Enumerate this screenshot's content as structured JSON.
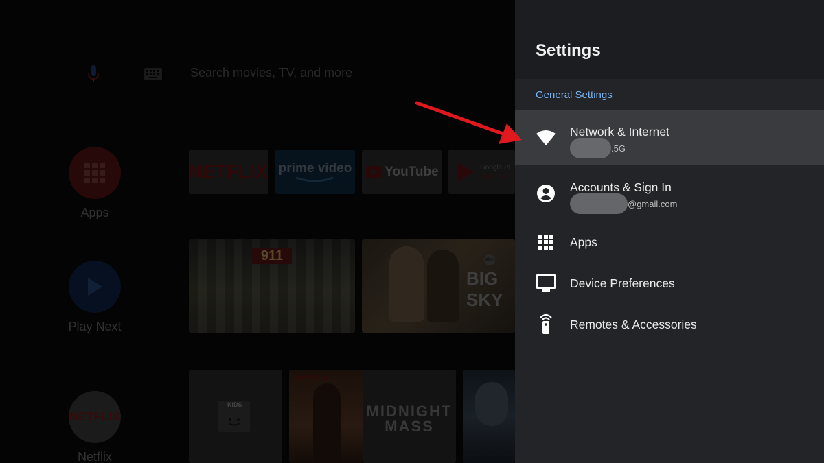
{
  "home": {
    "search_placeholder": "Search movies, TV, and more",
    "rail": [
      {
        "label": "Apps",
        "icon": "grid-icon"
      },
      {
        "label": "Play Next",
        "icon": "play-icon"
      },
      {
        "label": "Netflix",
        "icon": "netflix-logo",
        "logo_text": "NETFLIX"
      }
    ],
    "app_tiles": [
      {
        "name": "NETFLIX"
      },
      {
        "name": "prime video"
      },
      {
        "name": "YouTube"
      },
      {
        "name": "Google Play Movies & TV",
        "line1": "Google Pl",
        "line2": "Movies & T"
      }
    ],
    "media_row1": [
      {
        "title": "911"
      },
      {
        "title": "BIG SKY",
        "badge": "abc"
      }
    ],
    "media_row2": [
      {
        "title": "KIDS"
      },
      {
        "title": "NETFLIX"
      },
      {
        "title_line1": "MIDNIGHT",
        "title_line2": "MASS"
      },
      {
        "title": ""
      }
    ]
  },
  "settings": {
    "title": "Settings",
    "section": "General Settings",
    "rows": [
      {
        "title": "Network & Internet",
        "subtitle_suffix": ".5G",
        "icon": "wifi-icon",
        "selected": true
      },
      {
        "title": "Accounts & Sign In",
        "subtitle_suffix": "@gmail.com",
        "icon": "account-circle-icon"
      },
      {
        "title": "Apps",
        "icon": "apps-grid-icon"
      },
      {
        "title": "Device Preferences",
        "icon": "tv-icon"
      },
      {
        "title": "Remotes & Accessories",
        "icon": "remote-icon"
      }
    ]
  },
  "colors": {
    "panel_bg": "#222427",
    "selected_row": "#393b3f",
    "section_label": "#7ab4f5",
    "arrow": "#e0191f"
  }
}
